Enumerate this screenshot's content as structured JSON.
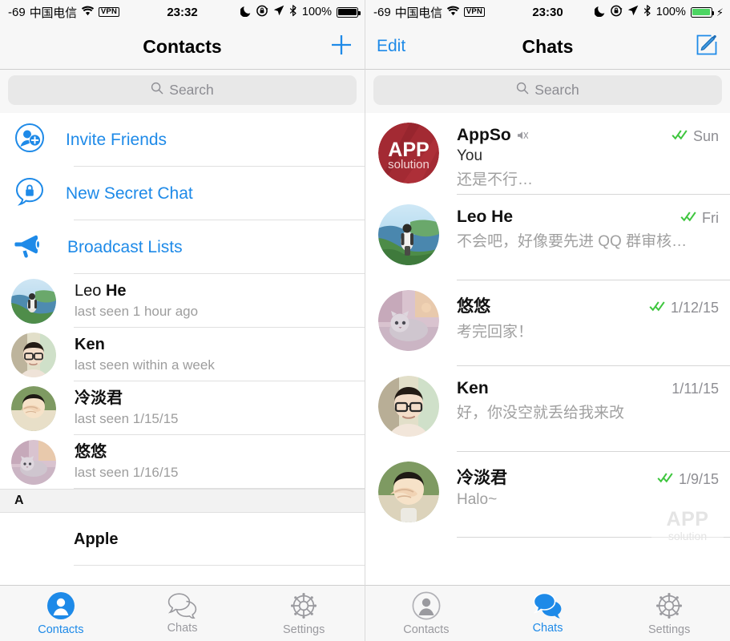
{
  "accent_blue": "#1e8ae8",
  "check_green": "#3ec63e",
  "muted_gray": "#9a9a9f",
  "appso_red": "#a32a33",
  "left": {
    "statusbar": {
      "rssi": "-69",
      "carrier": "中国电信",
      "wifi_icon": "wifi-icon",
      "vpn_badge": "VPN",
      "time": "23:32",
      "moon_icon": "do-not-disturb-moon-icon",
      "lock_icon": "rotation-lock-icon",
      "location_icon": "location-arrow-icon",
      "bluetooth_icon": "bluetooth-icon",
      "battery_pct": "100%",
      "battery_state": "full-black"
    },
    "navbar": {
      "title": "Contacts",
      "right_icon": "plus-icon"
    },
    "search": {
      "placeholder": "Search",
      "icon": "search-icon"
    },
    "actions": [
      {
        "label": "Invite Friends",
        "icon": "add-person-icon"
      },
      {
        "label": "New Secret Chat",
        "icon": "lock-bubble-icon"
      },
      {
        "label": "Broadcast Lists",
        "icon": "megaphone-icon"
      }
    ],
    "contacts": [
      {
        "first": "Leo ",
        "last": "He",
        "cjk": false,
        "sub": "last seen 1 hour ago",
        "avatar": "beach-hiker-photo"
      },
      {
        "first": "",
        "last": "Ken",
        "cjk": false,
        "sub": "last seen within a week",
        "avatar": "glasses-boy-photo"
      },
      {
        "first": "",
        "last": "冷淡君",
        "cjk": true,
        "sub": "last seen 1/15/15",
        "avatar": "hand-face-boy-photo"
      },
      {
        "first": "",
        "last": "悠悠",
        "cjk": true,
        "sub": "last seen 1/16/15",
        "avatar": "cat-photo"
      }
    ],
    "section_header": "A",
    "section_rows": [
      {
        "name": "Apple"
      }
    ],
    "tabs": [
      {
        "label": "Contacts",
        "icon": "person-filled-icon",
        "active": true
      },
      {
        "label": "Chats",
        "icon": "chat-bubbles-icon",
        "active": false
      },
      {
        "label": "Settings",
        "icon": "gear-icon",
        "active": false
      }
    ]
  },
  "right": {
    "statusbar": {
      "rssi": "-69",
      "carrier": "中国电信",
      "wifi_icon": "wifi-icon",
      "vpn_badge": "VPN",
      "time": "23:30",
      "moon_icon": "do-not-disturb-moon-icon",
      "lock_icon": "rotation-lock-icon",
      "location_icon": "location-arrow-icon",
      "bluetooth_icon": "bluetooth-icon",
      "battery_pct": "100%",
      "battery_state": "charging-green",
      "bolt_icon": "charging-bolt-icon"
    },
    "navbar": {
      "left_label": "Edit",
      "title": "Chats",
      "right_icon": "compose-icon"
    },
    "search": {
      "placeholder": "Search",
      "icon": "search-icon"
    },
    "chats": [
      {
        "name": "AppSo",
        "muted": true,
        "mute_icon": "muted-speaker-icon",
        "you_prefix": "You",
        "message": "还是不行…",
        "date": "Sun",
        "read": true,
        "avatar": "appso-logo"
      },
      {
        "name": "Leo He",
        "muted": false,
        "you_prefix": "",
        "message": "不会吧，好像要先进 QQ 群审核…",
        "date": "Fri",
        "read": true,
        "avatar": "beach-hiker-photo"
      },
      {
        "name": "悠悠",
        "muted": false,
        "you_prefix": "",
        "message": "考完回家！",
        "date": "1/12/15",
        "read": true,
        "avatar": "cat-photo"
      },
      {
        "name": "Ken",
        "muted": false,
        "you_prefix": "",
        "message": "好，你没空就丢给我来改",
        "date": "1/11/15",
        "read": false,
        "avatar": "glasses-boy-photo"
      },
      {
        "name": "冷淡君",
        "muted": false,
        "you_prefix": "",
        "message": "Halo~",
        "date": "1/9/15",
        "read": true,
        "avatar": "hand-face-boy-photo"
      }
    ],
    "watermark": {
      "line1": "APP",
      "line2": "solution"
    },
    "tabs": [
      {
        "label": "Contacts",
        "icon": "person-outline-icon",
        "active": false
      },
      {
        "label": "Chats",
        "icon": "chat-bubbles-filled-icon",
        "active": true
      },
      {
        "label": "Settings",
        "icon": "gear-icon",
        "active": false
      }
    ]
  }
}
